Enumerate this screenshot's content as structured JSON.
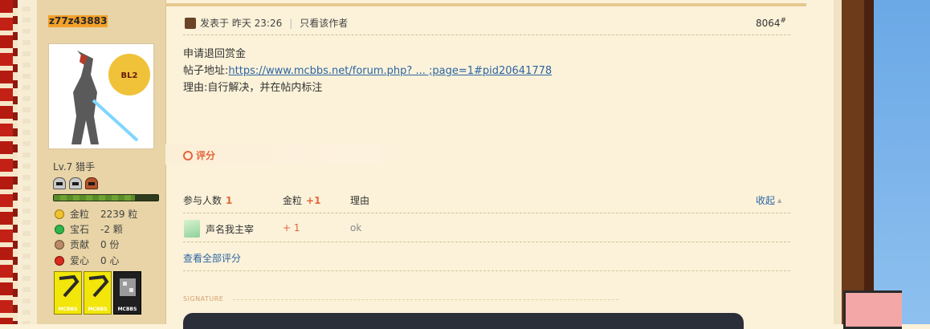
{
  "author": {
    "username": "z77z43883",
    "level": "Lv.7 猎手",
    "stats": [
      {
        "label": "金粒",
        "value": "2239 粒",
        "icon": "gold-nugget-icon",
        "color": "#f2c12e"
      },
      {
        "label": "宝石",
        "value": "-2 颗",
        "icon": "emerald-icon",
        "color": "#2fb64a"
      },
      {
        "label": "贡献",
        "value": "0 份",
        "icon": "contribution-icon",
        "color": "#b98a6a"
      },
      {
        "label": "爱心",
        "value": "0 心",
        "icon": "heart-apple-icon",
        "color": "#d92a1e"
      }
    ],
    "medals": [
      "MCBBS",
      "MCBBS",
      "MCBBS"
    ]
  },
  "post": {
    "posted_label": "发表于 昨天 23:26",
    "only_author_label": "只看该作者",
    "floor_number": "8064",
    "floor_suffix": "#",
    "line1": "申请退回赏金",
    "link_prefix": "帖子地址:",
    "link_text": "https://www.mcbbs.net/forum.php? ... ;page=1#pid20641778",
    "line3": "理由:自行解决，并在帖内标注"
  },
  "rating": {
    "title": "评分",
    "participants_label": "参与人数",
    "participants_count": "1",
    "gold_label": "金粒",
    "gold_total": "+1",
    "reason_header": "理由",
    "collapse_label": "收起",
    "rows": [
      {
        "user": "声名我主宰",
        "gold": "+ 1",
        "reason": "ok"
      }
    ],
    "view_all_label": "查看全部评分"
  },
  "signature_label": "SIGNATURE"
}
